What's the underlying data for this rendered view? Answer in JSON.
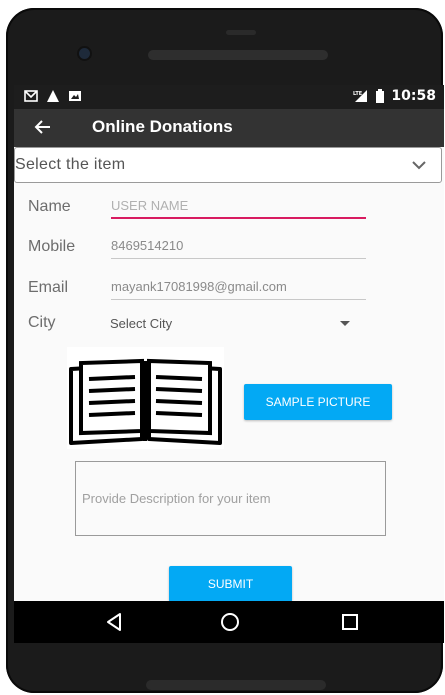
{
  "status_bar": {
    "time": "10:58",
    "left_icons": [
      "gmail-icon",
      "warning-icon",
      "image-icon"
    ],
    "right_icons": [
      "lte-signal-icon",
      "battery-icon"
    ]
  },
  "app_bar": {
    "title": "Online Donations",
    "back_icon": "arrow-back-icon"
  },
  "item_select": {
    "label": "Select the item",
    "icon": "chevron-down-icon"
  },
  "form": {
    "name_label": "Name",
    "name_placeholder": "USER NAME",
    "mobile_label": "Mobile",
    "mobile_value": "8469514210",
    "email_label": "Email",
    "email_value": "mayank17081998@gmail.com",
    "city_label": "City",
    "city_value": "Select City"
  },
  "picture": {
    "icon": "open-book-icon"
  },
  "buttons": {
    "sample_picture": "SAMPLE PICTURE",
    "submit": "SUBMIT"
  },
  "description": {
    "placeholder": "Provide Description for your item"
  },
  "nav_bar": {
    "icons": [
      "back-triangle-icon",
      "home-circle-icon",
      "recents-square-icon"
    ]
  },
  "colors": {
    "accent_button": "#03a9f4",
    "active_underline": "#d81b60",
    "app_bar": "#333333",
    "status_bar": "#1d1d1d"
  }
}
